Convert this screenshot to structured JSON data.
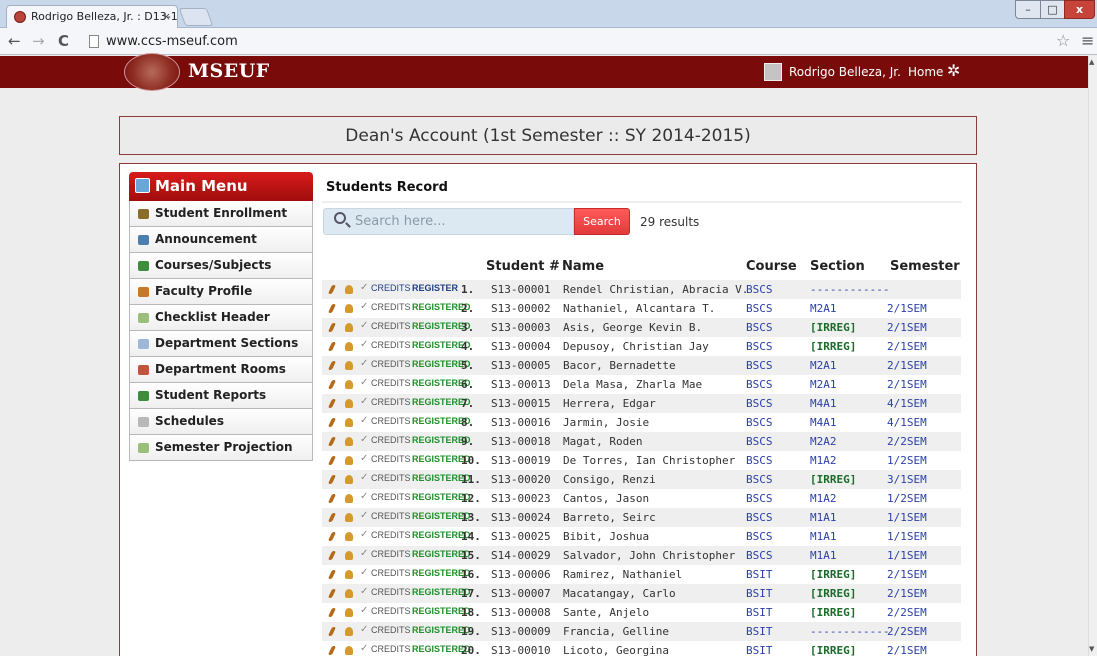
{
  "browser": {
    "tab_title": "Rodrigo Belleza, Jr. : D13-1",
    "tab_close": "×",
    "url": "www.ccs-mseuf.com",
    "window_controls": {
      "minimize": "–",
      "maximize": "□",
      "close": "x"
    }
  },
  "header": {
    "logo_text": "MSEUF",
    "user_name": "Rodrigo Belleza, Jr.",
    "home_label": "Home"
  },
  "page": {
    "dean_title": "Dean's Account (1st Semester :: SY 2014-2015)"
  },
  "sidebar": {
    "title": "Main Menu",
    "items": [
      {
        "label": "Student Enrollment",
        "icon": "enrollment-icon",
        "color": "#8a6d2a"
      },
      {
        "label": "Announcement",
        "icon": "announcement-icon",
        "color": "#4a7fb0"
      },
      {
        "label": "Courses/Subjects",
        "icon": "courses-icon",
        "color": "#3d8d3d"
      },
      {
        "label": "Faculty Profile",
        "icon": "faculty-icon",
        "color": "#c8782c"
      },
      {
        "label": "Checklist Header",
        "icon": "checklist-icon",
        "color": "#9bbf7a"
      },
      {
        "label": "Department Sections",
        "icon": "sections-icon",
        "color": "#9eb7d6"
      },
      {
        "label": "Department Rooms",
        "icon": "rooms-icon",
        "color": "#c2543e"
      },
      {
        "label": "Student Reports",
        "icon": "reports-icon",
        "color": "#3d8d3d"
      },
      {
        "label": "Schedules",
        "icon": "schedules-icon",
        "color": "#b8b8b8"
      },
      {
        "label": "Semester Projection",
        "icon": "projection-icon",
        "color": "#9bbf7a"
      }
    ]
  },
  "records": {
    "title": "Students Record",
    "search_placeholder": "Search here...",
    "search_button": "Search",
    "result_count": "29 results",
    "columns": {
      "student_no": "Student #",
      "name": "Name",
      "course": "Course",
      "section": "Section",
      "semester": "Semester"
    },
    "action_labels": {
      "credits": "CREDITS",
      "register": "REGISTER",
      "registered": "REGISTERED"
    },
    "rows": [
      {
        "num": "1.",
        "id": "S13-00001",
        "name": "Rendel Christian, Abracia V.",
        "course": "BSCS",
        "section": "------------",
        "semester": "",
        "registered": false
      },
      {
        "num": "2.",
        "id": "S13-00002",
        "name": "Nathaniel, Alcantara T.",
        "course": "BSCS",
        "section": "M2A1",
        "semester": "2/1SEM",
        "registered": true
      },
      {
        "num": "3.",
        "id": "S13-00003",
        "name": "Asis, George Kevin B.",
        "course": "BSCS",
        "section": "[IRREG]",
        "semester": "2/1SEM",
        "registered": true
      },
      {
        "num": "4.",
        "id": "S13-00004",
        "name": "Depusoy, Christian Jay",
        "course": "BSCS",
        "section": "[IRREG]",
        "semester": "2/1SEM",
        "registered": true
      },
      {
        "num": "5.",
        "id": "S13-00005",
        "name": "Bacor, Bernadette",
        "course": "BSCS",
        "section": "M2A1",
        "semester": "2/1SEM",
        "registered": true
      },
      {
        "num": "6.",
        "id": "S13-00013",
        "name": "Dela Masa, Zharla Mae",
        "course": "BSCS",
        "section": "M2A1",
        "semester": "2/1SEM",
        "registered": true
      },
      {
        "num": "7.",
        "id": "S13-00015",
        "name": "Herrera, Edgar",
        "course": "BSCS",
        "section": "M4A1",
        "semester": "4/1SEM",
        "registered": true
      },
      {
        "num": "8.",
        "id": "S13-00016",
        "name": "Jarmin, Josie",
        "course": "BSCS",
        "section": "M4A1",
        "semester": "4/1SEM",
        "registered": true
      },
      {
        "num": "9.",
        "id": "S13-00018",
        "name": "Magat, Roden",
        "course": "BSCS",
        "section": "M2A2",
        "semester": "2/2SEM",
        "registered": true
      },
      {
        "num": "10.",
        "id": "S13-00019",
        "name": "De Torres, Ian Christopher",
        "course": "BSCS",
        "section": "M1A2",
        "semester": "1/2SEM",
        "registered": true
      },
      {
        "num": "11.",
        "id": "S13-00020",
        "name": "Consigo, Renzi",
        "course": "BSCS",
        "section": "[IRREG]",
        "semester": "3/1SEM",
        "registered": true
      },
      {
        "num": "12.",
        "id": "S13-00023",
        "name": "Cantos, Jason",
        "course": "BSCS",
        "section": "M1A2",
        "semester": "1/2SEM",
        "registered": true
      },
      {
        "num": "13.",
        "id": "S13-00024",
        "name": "Barreto, Seirc",
        "course": "BSCS",
        "section": "M1A1",
        "semester": "1/1SEM",
        "registered": true
      },
      {
        "num": "14.",
        "id": "S13-00025",
        "name": "Bibit, Joshua",
        "course": "BSCS",
        "section": "M1A1",
        "semester": "1/1SEM",
        "registered": true
      },
      {
        "num": "15.",
        "id": "S14-00029",
        "name": "Salvador, John Christopher",
        "course": "BSCS",
        "section": "M1A1",
        "semester": "1/1SEM",
        "registered": true
      },
      {
        "num": "16.",
        "id": "S13-00006",
        "name": "Ramirez, Nathaniel",
        "course": "BSIT",
        "section": "[IRREG]",
        "semester": "2/1SEM",
        "registered": true
      },
      {
        "num": "17.",
        "id": "S13-00007",
        "name": "Macatangay, Carlo",
        "course": "BSIT",
        "section": "[IRREG]",
        "semester": "2/1SEM",
        "registered": true
      },
      {
        "num": "18.",
        "id": "S13-00008",
        "name": "Sante, Anjelo",
        "course": "BSIT",
        "section": "[IRREG]",
        "semester": "2/2SEM",
        "registered": true
      },
      {
        "num": "19.",
        "id": "S13-00009",
        "name": "Francia, Gelline",
        "course": "BSIT",
        "section": "------------",
        "semester": "2/2SEM",
        "registered": true
      },
      {
        "num": "20.",
        "id": "S13-00010",
        "name": "Licoto, Georgina",
        "course": "BSIT",
        "section": "[IRREG]",
        "semester": "2/1SEM",
        "registered": true
      }
    ]
  }
}
